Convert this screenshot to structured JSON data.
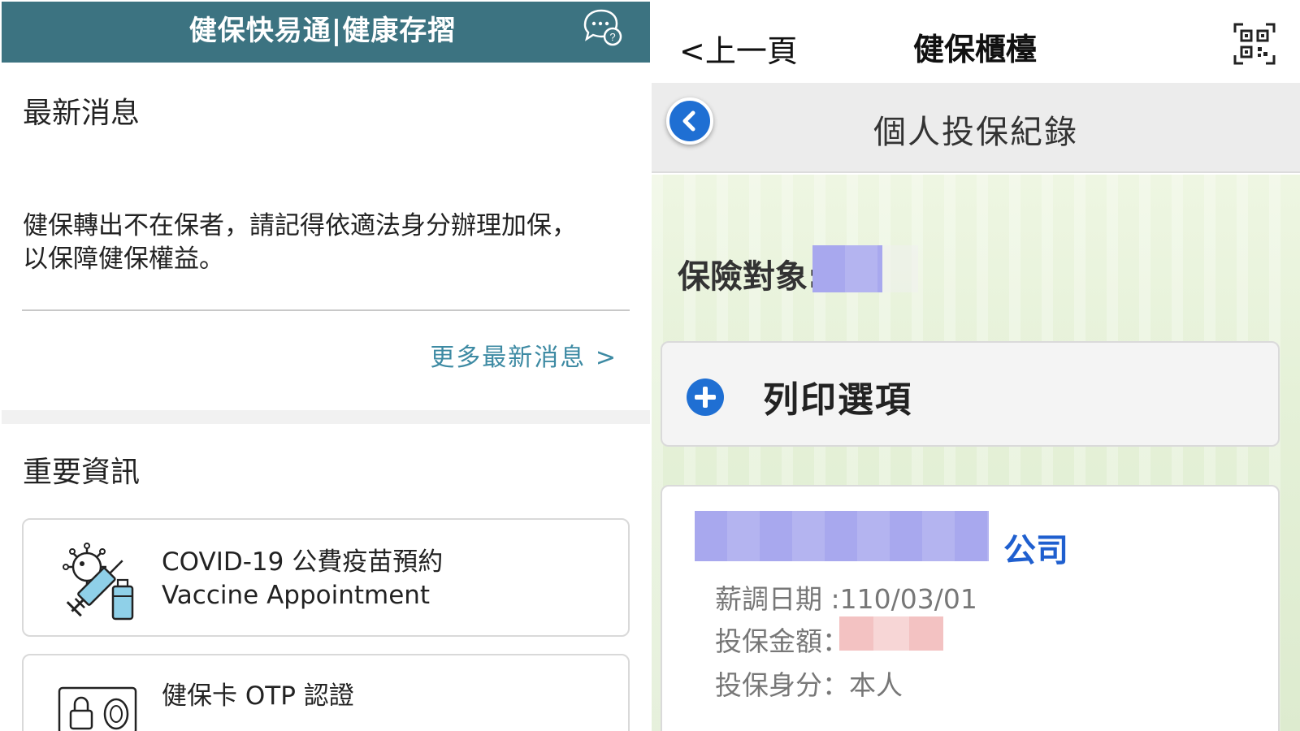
{
  "left": {
    "header": {
      "title": "健保快易通|健康存摺",
      "chat_icon": "chat-help-icon",
      "color": "#3c7381"
    },
    "news": {
      "title": "最新消息",
      "text": "健保轉出不在保者，請記得依適法身分辦理加保，以保障健保權益。",
      "more_link": "更多最新消息 >"
    },
    "important": {
      "title": "重要資訊",
      "cards": [
        {
          "icon": "vaccine-icon",
          "label_zh": "COVID-19 公費疫苗預約",
          "label_en": "Vaccine Appointment"
        },
        {
          "icon": "otp-card-icon",
          "label_zh": "健保卡 OTP 認證"
        }
      ]
    }
  },
  "right": {
    "topbar": {
      "back_label": "<上一頁",
      "title": "健保櫃檯",
      "qr_icon": "qr-code-icon"
    },
    "subbar": {
      "title": "個人投保紀錄",
      "back_icon": "chevron-left-icon"
    },
    "insured": {
      "label": "保險對象:"
    },
    "print_option": {
      "label": "列印選項",
      "icon": "plus-circle-icon"
    },
    "record": {
      "company_suffix": "公司",
      "salary_date": "薪調日期 :110/03/01",
      "amount_label": "投保金額：",
      "identity": "投保身分：本人"
    },
    "accent": "#1f6fd3"
  }
}
